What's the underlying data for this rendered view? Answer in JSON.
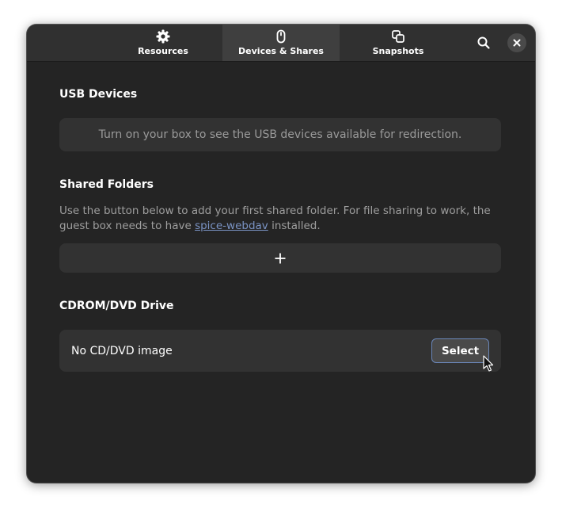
{
  "tabs": [
    {
      "label": "Resources",
      "icon": "gear-icon",
      "active": false
    },
    {
      "label": "Devices & Shares",
      "icon": "mouse-icon",
      "active": true
    },
    {
      "label": "Snapshots",
      "icon": "snapshots-icon",
      "active": false
    }
  ],
  "header": {
    "search_icon": "search-icon",
    "close_icon": "close-icon"
  },
  "usb": {
    "title": "USB Devices",
    "message": "Turn on your box to see the USB devices available for redirection."
  },
  "shared_folders": {
    "title": "Shared Folders",
    "description_before": "Use the button below to add your first shared folder. For file sharing to work, the guest box needs to have ",
    "link_text": "spice-webdav",
    "description_after": " installed.",
    "add_icon": "plus-icon"
  },
  "cdrom": {
    "title": "CDROM/DVD Drive",
    "status": "No CD/DVD image",
    "select_label": "Select"
  },
  "colors": {
    "window_bg": "#242424",
    "headerbar_bg": "#303030",
    "active_tab_bg": "#3f3f3f",
    "card_bg": "#323232",
    "link": "#7a93c4",
    "focus_border": "#6a86b8"
  }
}
